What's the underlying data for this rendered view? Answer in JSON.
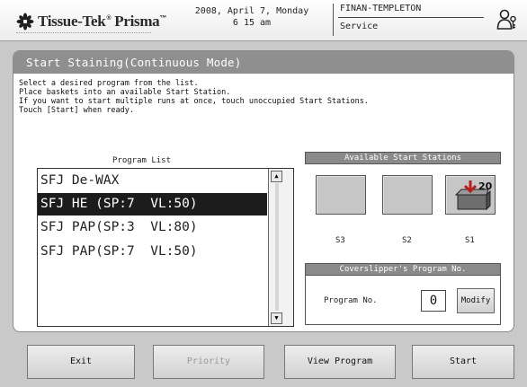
{
  "header": {
    "logo_text": "Tissue-Tek",
    "logo_text2": "Prisma",
    "logo_tm": "™",
    "date": "2008, April 7, Monday",
    "time": "6 15 am",
    "user_name": "FINAN-TEMPLETON",
    "user_role": "Service",
    "user_icon": "user-key-icon"
  },
  "screen": {
    "title": "Start Staining(Continuous Mode)",
    "instructions": [
      "Select a desired program from the list.",
      "Place baskets into an available Start Station.",
      "If you want to start multiple runs at once, touch unoccupied Start Stations.",
      "Touch [Start] when ready."
    ]
  },
  "program_list": {
    "label": "Program List",
    "items": [
      "SFJ De-WAX",
      "SFJ HE (SP:7  VL:50)",
      "SFJ PAP(SP:3  VL:80)",
      "SFJ PAP(SP:7  VL:50)"
    ],
    "selected_index": 1,
    "scroll_up_glyph": "▲",
    "scroll_down_glyph": "▼"
  },
  "stations": {
    "label": "Available Start Stations",
    "items": [
      {
        "label": "S3"
      },
      {
        "label": "S2"
      },
      {
        "label": "S1",
        "badge": "20"
      }
    ]
  },
  "coverslipper": {
    "label": "Coverslipper's  Program  No.",
    "program_label": "Program No.",
    "program_value": "0",
    "modify_label": "Modify"
  },
  "footer": {
    "exit": "Exit",
    "priority": "Priority",
    "view_program": "View Program",
    "start": "Start"
  },
  "colors": {
    "selected_row": "#1c1c1c",
    "title_bar": "#8f8f8f",
    "icon_red": "#b81e1e"
  }
}
